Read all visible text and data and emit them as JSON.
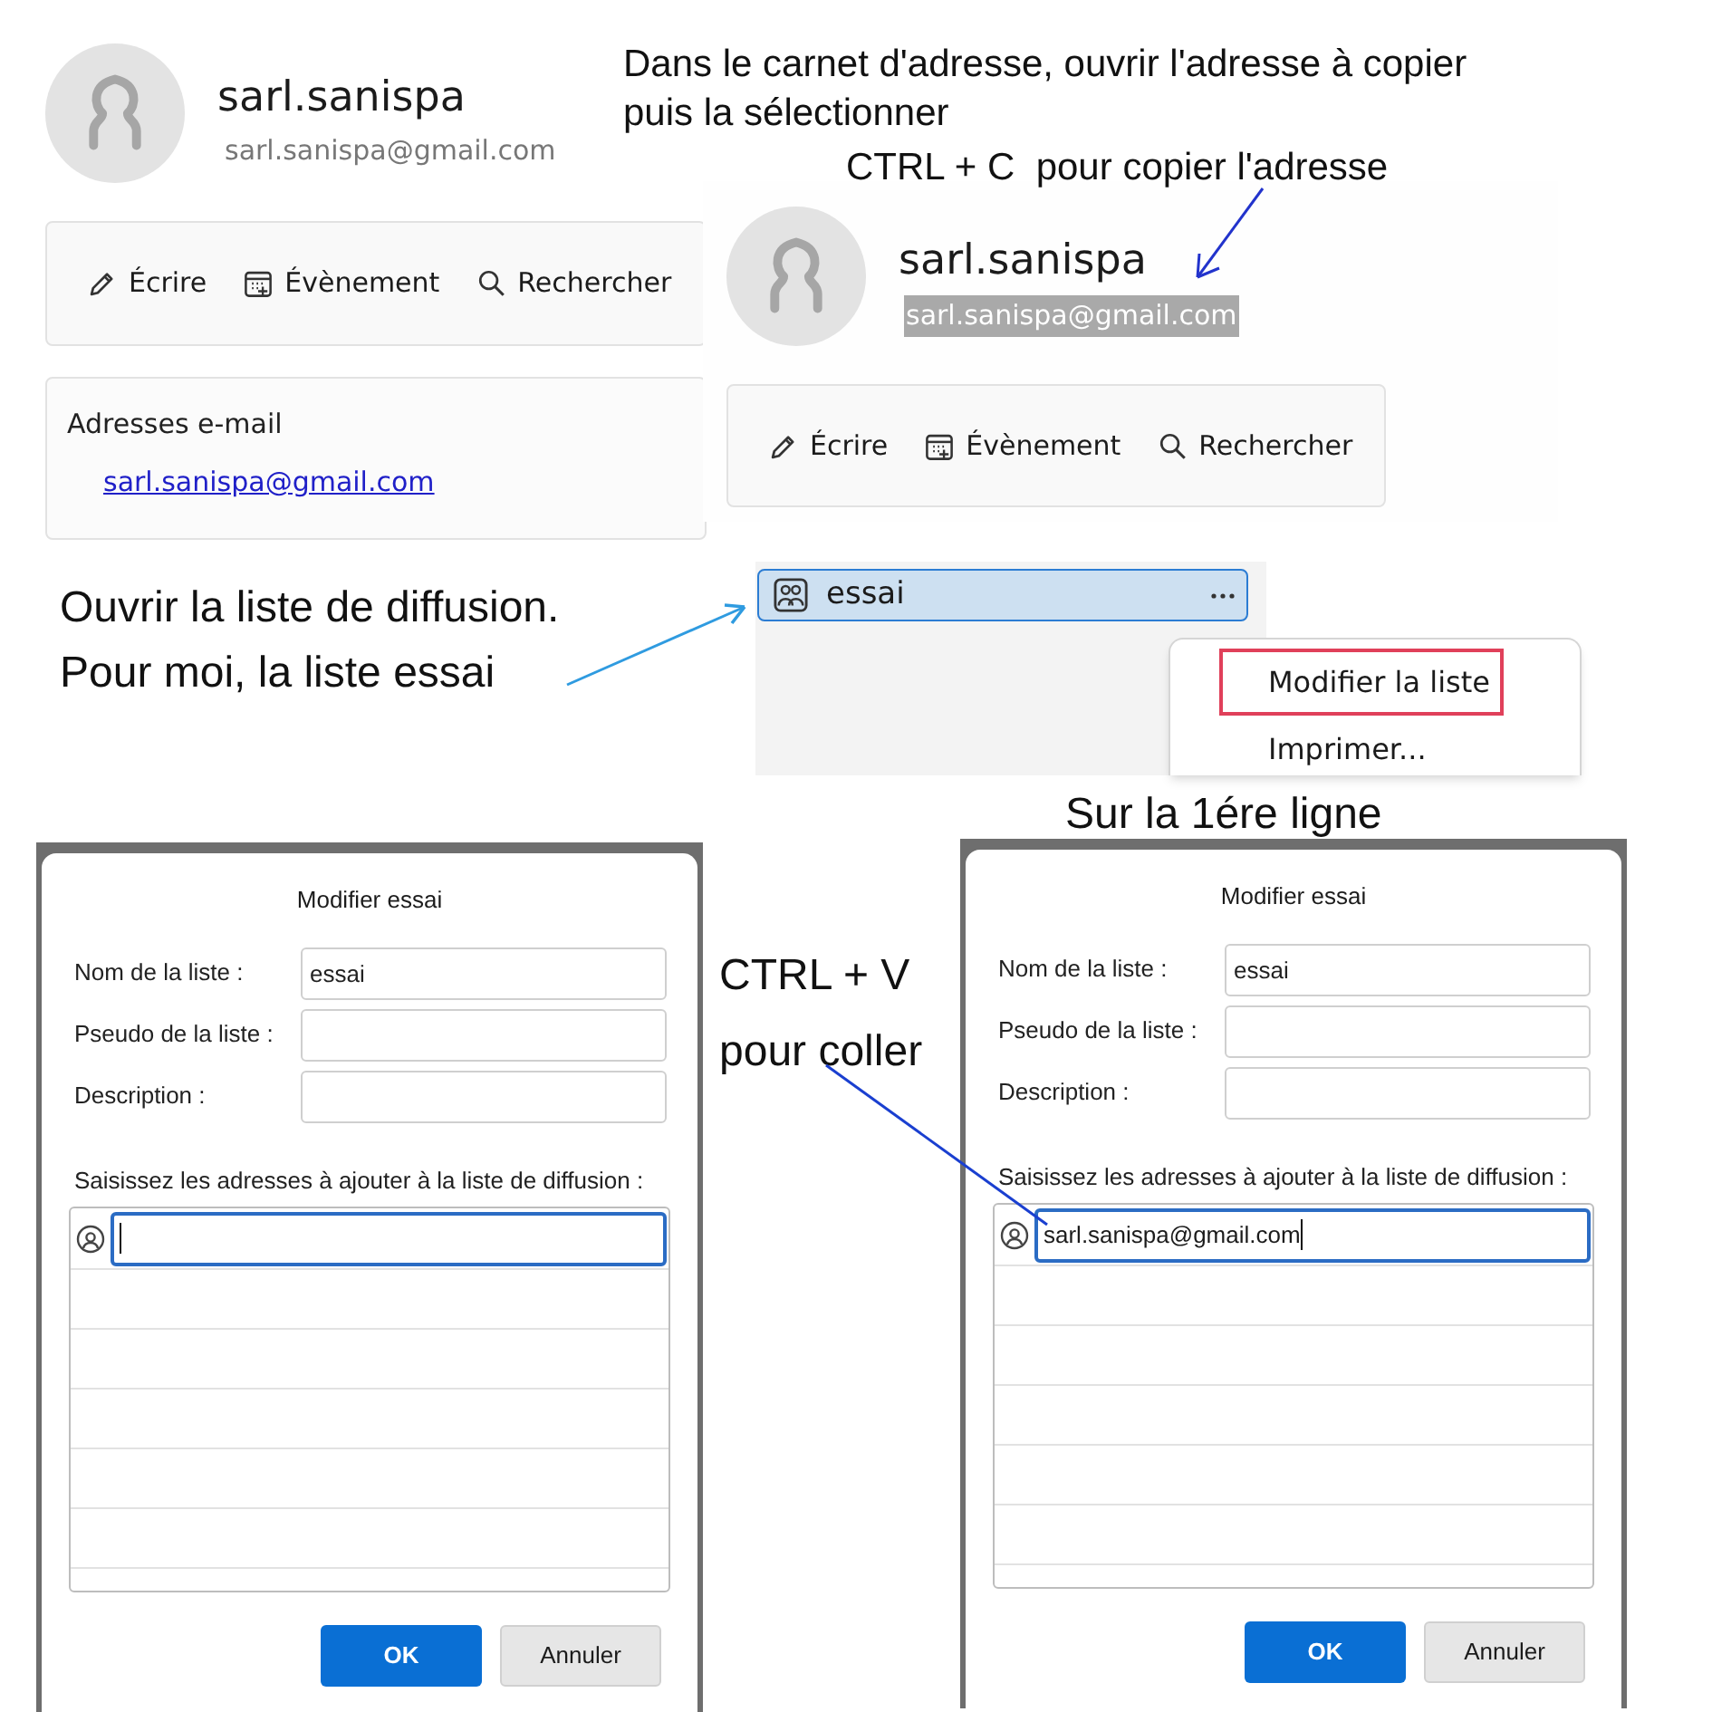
{
  "contact_cards": [
    {
      "name": "sarl.sanispa",
      "email": "sarl.sanispa@gmail.com",
      "email_selected": false,
      "toolbar": [
        {
          "kind": "write",
          "label": "Écrire"
        },
        {
          "kind": "event",
          "label": "Évènement"
        },
        {
          "kind": "search",
          "label": "Rechercher"
        }
      ],
      "email_section": {
        "title": "Adresses e-mail",
        "address": "sarl.sanispa@gmail.com"
      }
    },
    {
      "name": "sarl.sanispa",
      "email": "sarl.sanispa@gmail.com",
      "email_selected": true,
      "toolbar": [
        {
          "kind": "write",
          "label": "Écrire"
        },
        {
          "kind": "event",
          "label": "Évènement"
        },
        {
          "kind": "search",
          "label": "Rechercher"
        }
      ]
    }
  ],
  "instructions": [
    {
      "kind": "select",
      "text": "Dans le carnet d'adresse, ouvrir l'adresse à copier\npuis la sélectionner"
    },
    {
      "kind": "copy",
      "text": "CTRL + C  pour copier l'adresse"
    },
    {
      "kind": "open",
      "text": "Ouvrir la liste de diffusion.\nPour moi, la liste essai"
    },
    {
      "kind": "first",
      "text": "Sur la 1ére ligne"
    },
    {
      "kind": "paste",
      "text": "CTRL + V\npour coller"
    }
  ],
  "list_pane": {
    "items": [
      {
        "label": "essai",
        "selected": true
      }
    ]
  },
  "context_menu": [
    {
      "label": "Modifier la liste",
      "highlighted": true
    },
    {
      "label": "Imprimer...",
      "highlighted": false
    }
  ],
  "dialogs": [
    {
      "title": "Modifier essai",
      "fields": [
        {
          "label": "Nom de la liste :",
          "value": "essai"
        },
        {
          "label": "Pseudo de la liste :"
        },
        {
          "label": "Description :"
        }
      ],
      "addresses_label": "Saisissez les adresses à ajouter à la liste de diffusion :",
      "buttons": [
        {
          "kind": "primary",
          "label": "OK"
        },
        {
          "kind": "secondary",
          "label": "Annuler"
        }
      ]
    },
    {
      "title": "Modifier essai",
      "fields": [
        {
          "label": "Nom de la liste :",
          "value": "essai"
        },
        {
          "label": "Pseudo de la liste :"
        },
        {
          "label": "Description :"
        }
      ],
      "addresses_label": "Saisissez les adresses à ajouter à la liste de diffusion :",
      "address_entry": {
        "value": "sarl.sanispa@gmail.com"
      },
      "buttons": [
        {
          "kind": "primary",
          "label": "OK"
        },
        {
          "kind": "secondary",
          "label": "Annuler"
        }
      ]
    }
  ]
}
